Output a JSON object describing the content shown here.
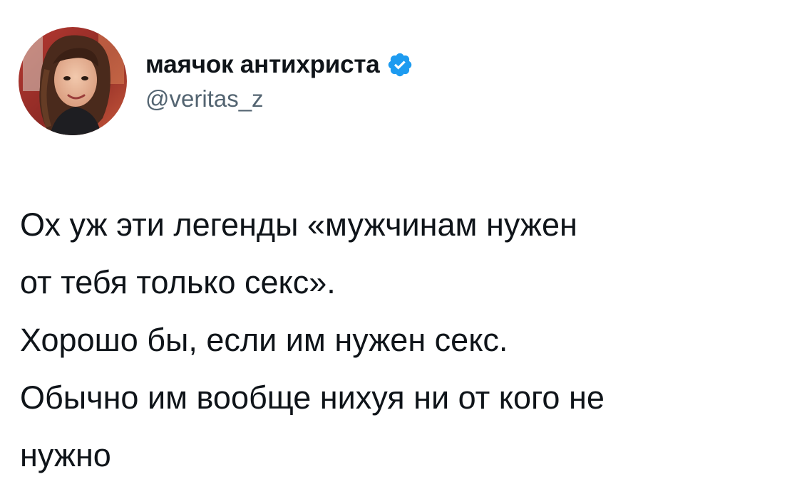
{
  "author": {
    "display_name": "маячок антихриста",
    "handle": "@veritas_z",
    "verified": true,
    "verified_icon": "verified-badge-icon",
    "avatar_icon": "user-avatar"
  },
  "tweet": {
    "lines": [
      "Ох уж эти легенды «мужчинам нужен",
      "от тебя только секс».",
      "Хорошо бы, если им нужен секс.",
      "Обычно им вообще нихуя ни от кого не",
      "нужно"
    ]
  },
  "colors": {
    "text": "#0f1419",
    "secondary_text": "#536471",
    "verified_blue": "#1d9bf0",
    "background": "#ffffff"
  }
}
